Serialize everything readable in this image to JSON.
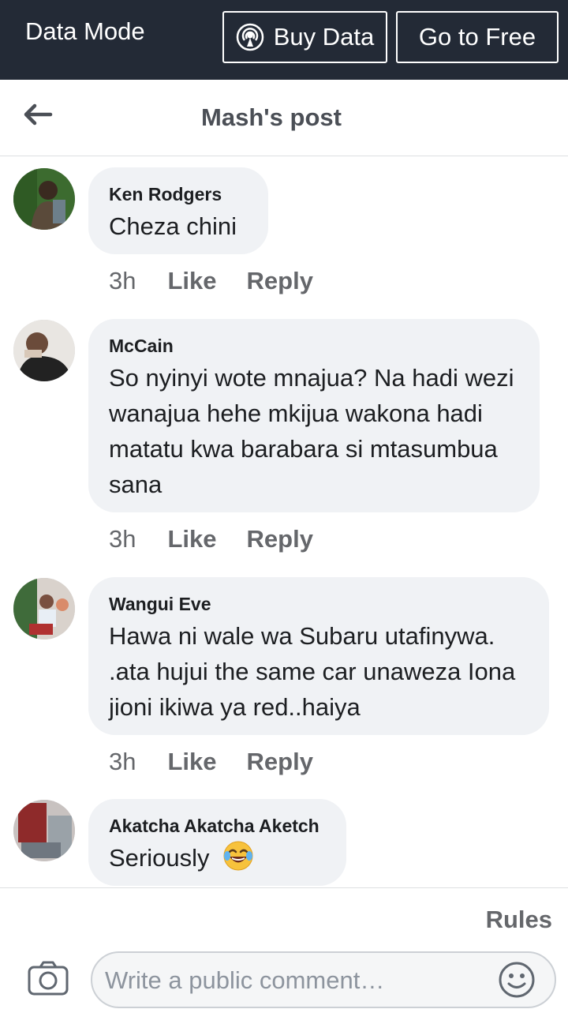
{
  "topbar": {
    "mode_label": "Data Mode",
    "buy_label": "Buy Data",
    "free_label": "Go to Free",
    "background": "#232a36"
  },
  "header": {
    "title": "Mash's post",
    "back_icon": "arrow-left-icon"
  },
  "comments": [
    {
      "author": "Ken Rodgers",
      "text": "Cheza chini",
      "time": "3h",
      "like": "Like",
      "reply": "Reply"
    },
    {
      "author": "McCain",
      "text": "So nyinyi wote mnajua? Na hadi wezi wanajua hehe mkijua wakona hadi matatu kwa barabara si mtasumbua sana",
      "time": "3h",
      "like": "Like",
      "reply": "Reply"
    },
    {
      "author": "Wangui Eve",
      "text": "Hawa ni wale wa Subaru utafinywa. .ata hujui the same car unaweza Iona jioni ikiwa ya red..haiya",
      "time": "3h",
      "like": "Like",
      "reply": "Reply"
    },
    {
      "author": "Akatcha Akatcha Aketch",
      "text": "Seriously",
      "emoji": "face-with-tears-of-joy-emoji"
    }
  ],
  "footer": {
    "rules_label": "Rules",
    "comment_placeholder": "Write a public comment…",
    "camera_icon": "camera-icon",
    "emoji_icon": "smiley-icon"
  },
  "colors": {
    "bubble": "#f0f2f5",
    "meta_text": "#65676b",
    "header_text": "#4b4f56"
  }
}
